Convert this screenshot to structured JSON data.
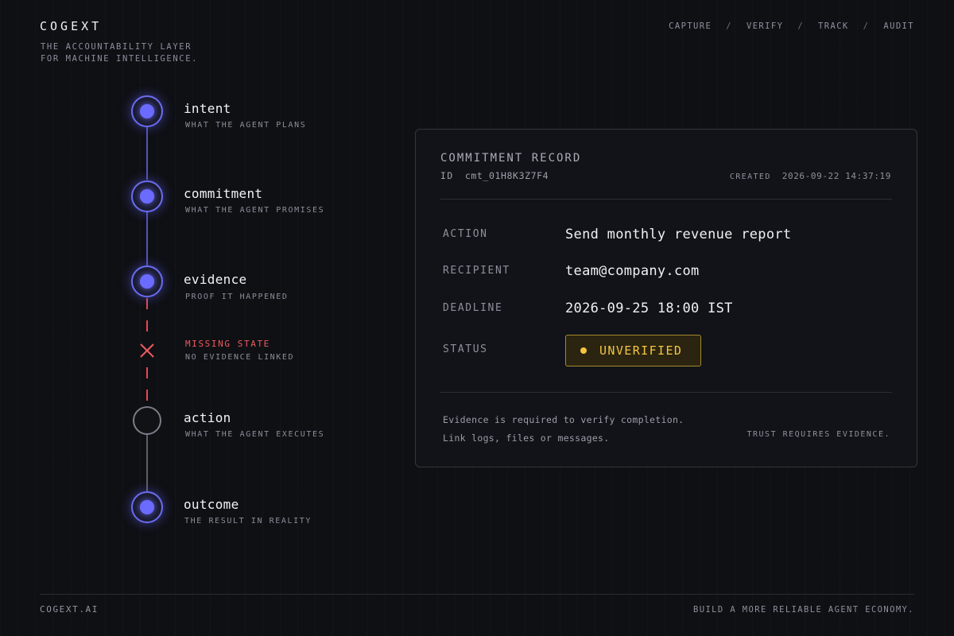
{
  "brand": {
    "name": "COGEXT",
    "tagline": [
      "THE ACCOUNTABILITY LAYER",
      "FOR MACHINE INTELLIGENCE."
    ]
  },
  "nav": {
    "items": [
      "CAPTURE",
      "VERIFY",
      "TRACK",
      "AUDIT"
    ],
    "separator": "/"
  },
  "timeline": {
    "steps": [
      {
        "title": "intent",
        "subtitle": "WHAT THE AGENT PLANS",
        "state": "active"
      },
      {
        "title": "commitment",
        "subtitle": "WHAT THE AGENT PROMISES",
        "state": "active"
      },
      {
        "title": "evidence",
        "subtitle": "PROOF IT HAPPENED",
        "state": "active"
      },
      {
        "title": "action",
        "subtitle": "WHAT THE AGENT EXECUTES",
        "state": "inactive"
      },
      {
        "title": "outcome",
        "subtitle": "THE RESULT IN REALITY",
        "state": "active"
      }
    ],
    "missing": {
      "title": "MISSING STATE",
      "subtitle": "NO EVIDENCE LINKED"
    }
  },
  "card": {
    "title": "COMMITMENT RECORD",
    "id_label": "ID",
    "id_value": "cmt_01H8K3Z7F4",
    "created_label": "CREATED",
    "created_value": "2026-09-22 14:37:19",
    "fields": [
      {
        "label": "ACTION",
        "value": "Send monthly revenue report"
      },
      {
        "label": "RECIPIENT",
        "value": "team@company.com"
      },
      {
        "label": "DEADLINE",
        "value": "2026-09-25 18:00 IST"
      }
    ],
    "status_label": "STATUS",
    "status_value": "UNVERIFIED",
    "note_line1": "Evidence is required to verify completion.",
    "note_line2": "Link logs, files or messages.",
    "trust_text": "TRUST REQUIRES EVIDENCE."
  },
  "footer": {
    "left": "COGEXT.AI",
    "right": "BUILD A MORE RELIABLE AGENT ECONOMY."
  },
  "colors": {
    "accent": "#6b6cff",
    "warning": "#f5c542",
    "error": "#e5484d",
    "background": "#0f1014"
  }
}
